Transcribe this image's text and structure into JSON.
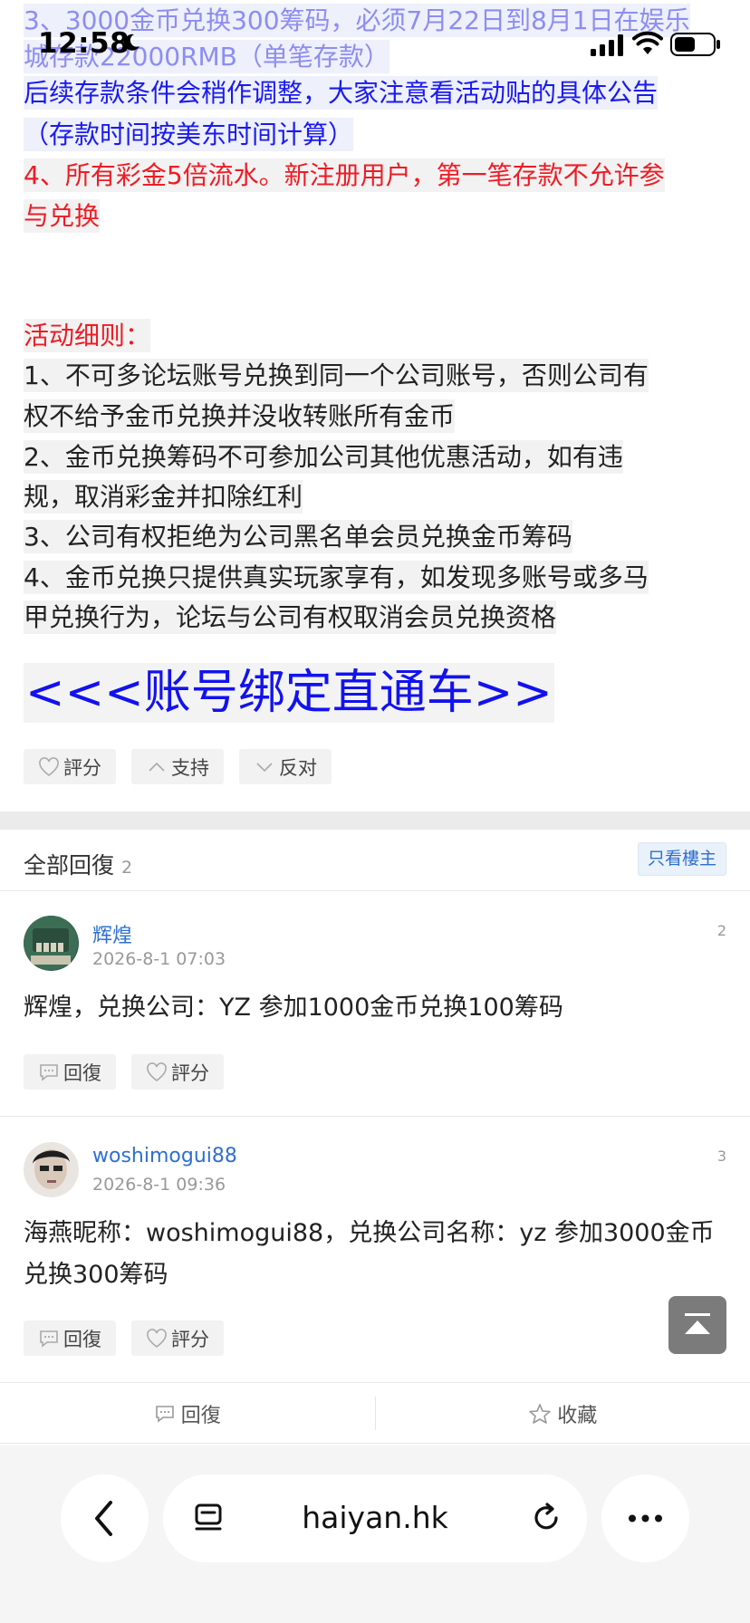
{
  "status_bar": {
    "time": "12:58"
  },
  "post": {
    "lines": [
      "3、3000金币兑换300筹码，必须7月22日到8月1日在娱乐",
      "城存款22000RMB（单笔存款）",
      "后续存款条件会稍作调整，大家注意看活动贴的具体公告",
      "（存款时间按美东时间计算）",
      "4、所有彩金5倍流水。新注册用户，第一笔存款不允许参",
      "与兑换",
      "活动细则：",
      "1、不可多论坛账号兑换到同一个公司账号，否则公司有",
      "权不给予金币兑换并没收转账所有金币",
      "2、金币兑换筹码不可参加公司其他优惠活动，如有违",
      "规，取消彩金并扣除红利",
      "3、公司有权拒绝为公司黑名单会员兑换金币筹码",
      "4、金币兑换只提供真实玩家享有，如发现多账号或多马",
      "甲兑换行为，论坛与公司有权取消会员兑换资格"
    ],
    "link_text": "<<<账号绑定直通车>>",
    "vote": {
      "rate": "評分",
      "support": "支持",
      "oppose": "反对"
    }
  },
  "replies": {
    "title": "全部回復",
    "count": "2",
    "only_owner": "只看樓主",
    "items": [
      {
        "user": "辉煌",
        "date": "2026-8-1 07:03",
        "floor": "2",
        "text": "辉煌，兑换公司：YZ  参加1000金币兑换100筹码",
        "reply": "回復",
        "rate": "評分"
      },
      {
        "user": "woshimogui88",
        "date": "2026-8-1 09:36",
        "floor": "3",
        "text": "海燕昵称：woshimogui88，兑换公司名称：yz  参加3000金币兑换300筹码",
        "reply": "回復",
        "rate": "評分"
      }
    ]
  },
  "bottom_actions": {
    "reply": "回復",
    "favorite": "收藏"
  },
  "browser": {
    "url": "haiyan.hk"
  },
  "colors": {
    "blue_text": "#1a1aef",
    "red_text": "#ee1c25",
    "link_blue": "#2f6fcf"
  }
}
